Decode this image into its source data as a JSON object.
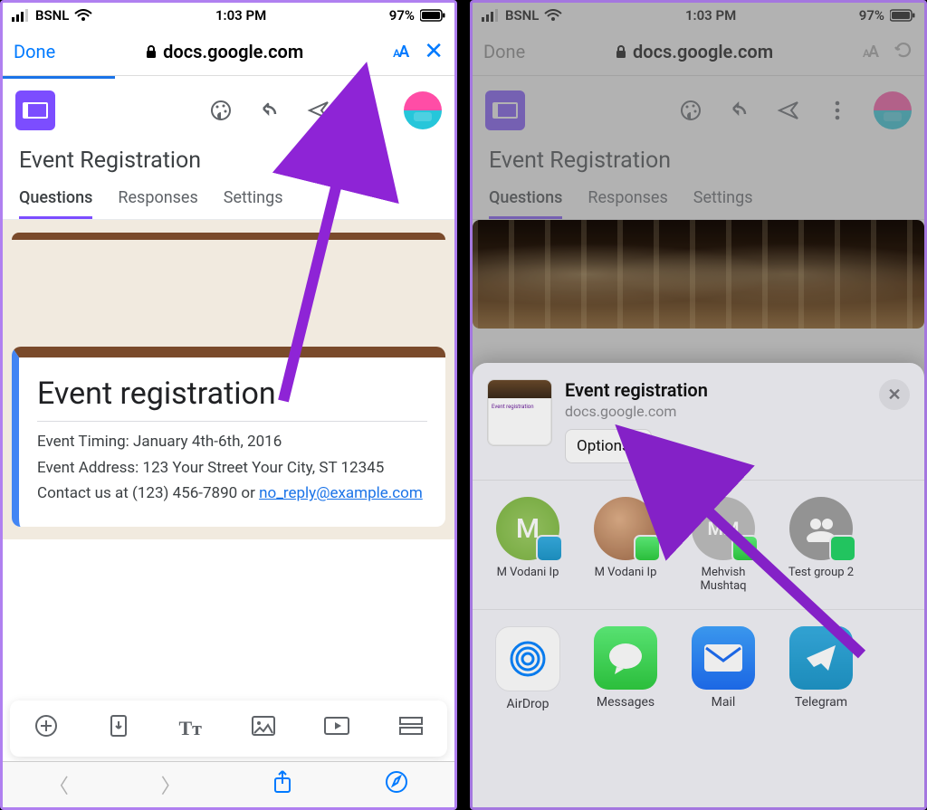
{
  "status": {
    "carrier": "BSNL",
    "time": "1:03 PM",
    "battery": "97%"
  },
  "safari": {
    "done": "Done",
    "url": "docs.google.com",
    "aa": "AA"
  },
  "gf": {
    "title": "Event Registration",
    "tabs": [
      "Questions",
      "Responses",
      "Settings"
    ]
  },
  "form": {
    "heading": "Event registration",
    "line1": "Event Timing: January 4th-6th, 2016",
    "line2": "Event Address: 123 Your Street Your City, ST 12345",
    "line3a": "Contact us at (123) 456-7890 or ",
    "email": "no_reply@example.com"
  },
  "sheet": {
    "title": "Event registration",
    "sub": "docs.google.com",
    "options": "Options",
    "contacts": [
      {
        "name": "M Vodani Ip",
        "type": "green",
        "letter": "M",
        "badge": "telegram"
      },
      {
        "name": "M Vodani Ip",
        "type": "photo",
        "badge": "imsg"
      },
      {
        "name": "Mehvish Mushtaq",
        "type": "gray",
        "letter": "MM",
        "badge": "imsg"
      },
      {
        "name": "Test group 2",
        "type": "groupgray",
        "badge": "whatsapp"
      }
    ],
    "apps": [
      {
        "name": "AirDrop",
        "cls": "airdrop"
      },
      {
        "name": "Messages",
        "cls": "messages"
      },
      {
        "name": "Mail",
        "cls": "mail"
      },
      {
        "name": "Telegram",
        "cls": "telegram"
      }
    ]
  }
}
